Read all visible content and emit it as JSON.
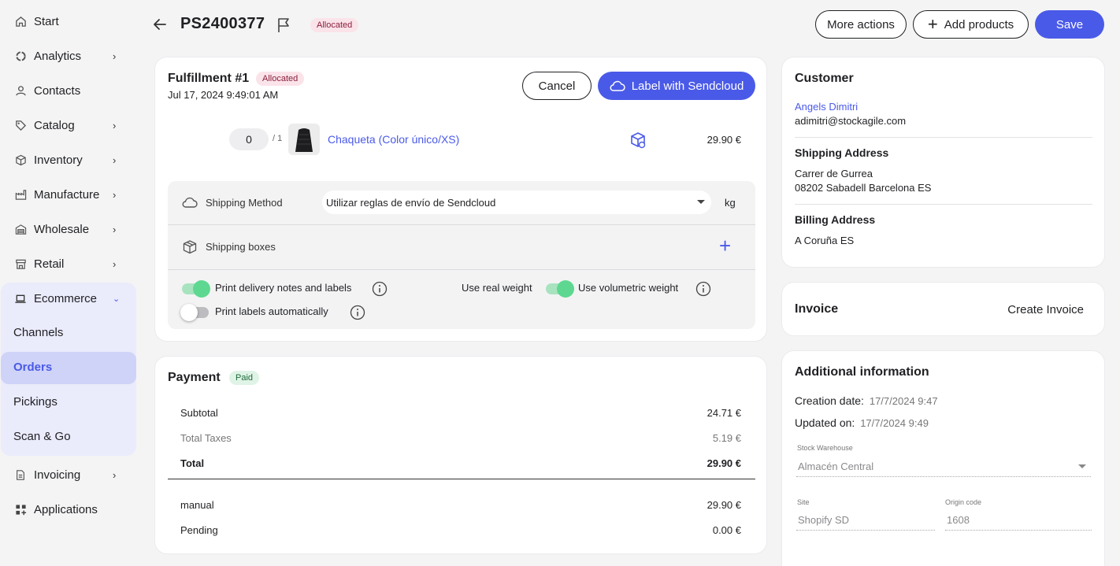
{
  "sidebar": {
    "items": [
      {
        "label": "Start",
        "icon": "home-icon"
      },
      {
        "label": "Analytics",
        "icon": "analytics-icon"
      },
      {
        "label": "Contacts",
        "icon": "user-icon"
      },
      {
        "label": "Catalog",
        "icon": "tag-icon"
      },
      {
        "label": "Inventory",
        "icon": "cube-icon"
      },
      {
        "label": "Manufacture",
        "icon": "factory-icon"
      },
      {
        "label": "Wholesale",
        "icon": "warehouse-icon"
      },
      {
        "label": "Retail",
        "icon": "store-icon"
      },
      {
        "label": "Ecommerce",
        "icon": "laptop-icon"
      },
      {
        "label": "Invoicing",
        "icon": "document-icon"
      },
      {
        "label": "Applications",
        "icon": "apps-icon"
      }
    ],
    "ecommerce_sub": [
      "Channels",
      "Orders",
      "Pickings",
      "Scan & Go"
    ]
  },
  "header": {
    "order_id": "PS2400377",
    "status": "Allocated",
    "more_actions": "More actions",
    "add_products": "Add products",
    "save": "Save"
  },
  "fulfillment": {
    "title": "Fulfillment #1",
    "status": "Allocated",
    "date": "Jul 17, 2024 9:49:01 AM",
    "cancel": "Cancel",
    "label_btn": "Label with Sendcloud",
    "item": {
      "qty": "0",
      "qty_total": "/ 1",
      "name": "Chaqueta (Color único/XS)",
      "price": "29.90 €"
    },
    "shipping_method_label": "Shipping Method",
    "shipping_method_value": "Utilizar reglas de envío de Sendcloud",
    "weight_unit": "kg",
    "shipping_boxes_label": "Shipping boxes",
    "print_delivery": "Print delivery notes and labels",
    "use_real_weight": "Use real weight",
    "use_volumetric": "Use volumetric weight",
    "print_auto": "Print labels automatically"
  },
  "payment": {
    "title": "Payment",
    "status": "Paid",
    "subtotal_label": "Subtotal",
    "subtotal": "24.71 €",
    "taxes_label": "Total Taxes",
    "taxes": "5.19 €",
    "total_label": "Total",
    "total": "29.90 €",
    "method_label": "manual",
    "method_amount": "29.90 €",
    "pending_label": "Pending",
    "pending": "0.00 €"
  },
  "customer": {
    "title": "Customer",
    "name": "Angels Dimitri",
    "email": "adimitri@stockagile.com",
    "shipping_title": "Shipping Address",
    "shipping_line1": "Carrer de Gurrea",
    "shipping_line2": "08202 Sabadell Barcelona ES",
    "billing_title": "Billing Address",
    "billing_line1": "A Coruña ES"
  },
  "invoice": {
    "title": "Invoice",
    "create": "Create Invoice"
  },
  "additional": {
    "title": "Additional information",
    "creation_label": "Creation date:",
    "creation_value": "17/7/2024 9:47",
    "updated_label": "Updated on:",
    "updated_value": "17/7/2024 9:49",
    "warehouse_label": "Stock Warehouse",
    "warehouse_value": "Almacén Central",
    "site_label": "Site",
    "site_value": "Shopify SD",
    "origin_label": "Origin code",
    "origin_value": "1608"
  },
  "colors": {
    "accent": "#4a5ae8",
    "allocated_bg": "#fbe3ea",
    "paid_bg": "#dff3e6",
    "toggle_on": "#5ed890"
  }
}
